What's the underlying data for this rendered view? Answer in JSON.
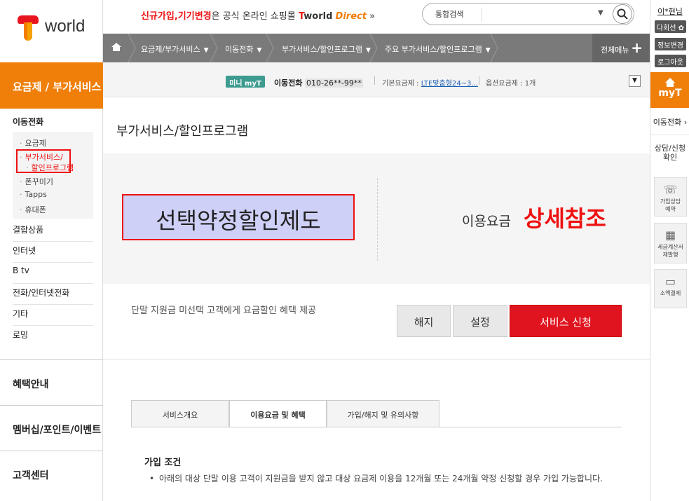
{
  "brand": {
    "logo_text": "world"
  },
  "header": {
    "promo_red": "신규가입,기기변경",
    "promo_text": "은 공식 온라인 쇼핑몰",
    "promo_brand": "world",
    "promo_direct": "Direct",
    "promo_arrow": "»",
    "search_label": "통합검색",
    "search_placeholder": ""
  },
  "breadcrumb": {
    "home_icon": "home-icon",
    "items": [
      "요금제/부가서비스",
      "이동전화",
      "부가서비스/할인프로그램",
      "주요 부가서비스/할인프로그램"
    ],
    "all_menu": "전체메뉴"
  },
  "mini": {
    "badge": "미니 myT",
    "line_label": "이동전화",
    "line_number": "010-26**-99**",
    "basic_label": "기본요금제 : ",
    "basic_value": "LTE맞춤형24~3...",
    "option": "옵션요금제 : 1개"
  },
  "sidebar": {
    "category": "요금제 / 부가서비스",
    "section": "이동전화",
    "sub_items": [
      "요금제",
      "부가서비스/",
      "할인프로그램",
      "폰꾸미기",
      "Tapps",
      "휴대폰"
    ],
    "items": [
      "결합상품",
      "인터넷",
      "B tv",
      "전화/인터넷전화",
      "기타",
      "로밍"
    ],
    "big": [
      "혜택안내",
      "멤버십/포인트/이벤트",
      "고객센터"
    ]
  },
  "main": {
    "page_title": "부가서비스/할인프로그램",
    "service_name": "선택약정할인제도",
    "fee_label": "이용요금",
    "fee_detail": "상세참조",
    "description": "단말 지원금 미선택 고객에게 요금할인 혜택 제공",
    "btn_cancel": "해지",
    "btn_setting": "설정",
    "btn_apply": "서비스 신청",
    "tabs": [
      "서비스개요",
      "이용요금 및 혜택",
      "가입/해지 및 유의사항"
    ],
    "cond_title": "가입 조건",
    "cond_text": "아래의 대상 단말 이용 고객이 지원금을 받지 않고 대상 요금제 이용을 12개월 또는 24개월 약정 신청할 경우 가입 가능합니다."
  },
  "right": {
    "user": "이*현님",
    "btns": [
      "다회선 ✿",
      "정보변경",
      "로그아웃"
    ],
    "myt": "myT",
    "mobile": "이동전화 ›",
    "consult": "상담/신청 확인",
    "icons": [
      {
        "icon": "phone-icon",
        "glyph": "☏",
        "line1": "가입상담",
        "line2": "예약"
      },
      {
        "icon": "calculator-icon",
        "glyph": "▦",
        "line1": "세금계산서",
        "line2": "재발행"
      },
      {
        "icon": "card-icon",
        "glyph": "▭",
        "line1": "소액결제",
        "line2": ""
      }
    ]
  },
  "colors": {
    "accent": "#f07f0a",
    "red": "#e0141f",
    "crumb_bg": "#7a7a7a"
  }
}
